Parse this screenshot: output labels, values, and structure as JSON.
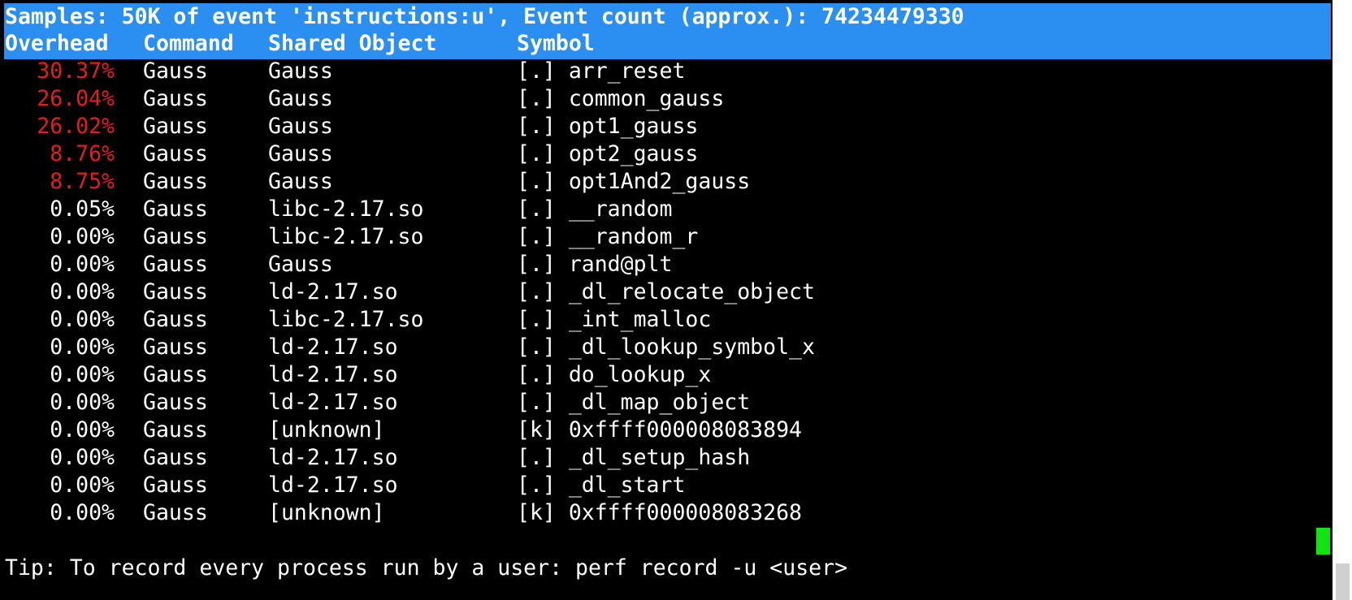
{
  "header": {
    "summary": "Samples: 50K of event 'instructions:u', Event count (approx.): 74234479330",
    "columns": {
      "overhead": "Overhead",
      "command": "Command",
      "shared_object": "Shared Object",
      "symbol": "Symbol"
    }
  },
  "rows": [
    {
      "overhead": "30.37%",
      "command": "Gauss",
      "shared_object": "Gauss",
      "symbol": "[.] arr_reset"
    },
    {
      "overhead": "26.04%",
      "command": "Gauss",
      "shared_object": "Gauss",
      "symbol": "[.] common_gauss"
    },
    {
      "overhead": "26.02%",
      "command": "Gauss",
      "shared_object": "Gauss",
      "symbol": "[.] opt1_gauss"
    },
    {
      "overhead": "8.76%",
      "command": "Gauss",
      "shared_object": "Gauss",
      "symbol": "[.] opt2_gauss"
    },
    {
      "overhead": "8.75%",
      "command": "Gauss",
      "shared_object": "Gauss",
      "symbol": "[.] opt1And2_gauss"
    },
    {
      "overhead": "0.05%",
      "command": "Gauss",
      "shared_object": "libc-2.17.so",
      "symbol": "[.] __random"
    },
    {
      "overhead": "0.00%",
      "command": "Gauss",
      "shared_object": "libc-2.17.so",
      "symbol": "[.] __random_r"
    },
    {
      "overhead": "0.00%",
      "command": "Gauss",
      "shared_object": "Gauss",
      "symbol": "[.] rand@plt"
    },
    {
      "overhead": "0.00%",
      "command": "Gauss",
      "shared_object": "ld-2.17.so",
      "symbol": "[.] _dl_relocate_object"
    },
    {
      "overhead": "0.00%",
      "command": "Gauss",
      "shared_object": "libc-2.17.so",
      "symbol": "[.] _int_malloc"
    },
    {
      "overhead": "0.00%",
      "command": "Gauss",
      "shared_object": "ld-2.17.so",
      "symbol": "[.] _dl_lookup_symbol_x"
    },
    {
      "overhead": "0.00%",
      "command": "Gauss",
      "shared_object": "ld-2.17.so",
      "symbol": "[.] do_lookup_x"
    },
    {
      "overhead": "0.00%",
      "command": "Gauss",
      "shared_object": "ld-2.17.so",
      "symbol": "[.] _dl_map_object"
    },
    {
      "overhead": "0.00%",
      "command": "Gauss",
      "shared_object": "[unknown]",
      "symbol": "[k] 0xffff000008083894"
    },
    {
      "overhead": "0.00%",
      "command": "Gauss",
      "shared_object": "ld-2.17.so",
      "symbol": "[.] _dl_setup_hash"
    },
    {
      "overhead": "0.00%",
      "command": "Gauss",
      "shared_object": "ld-2.17.so",
      "symbol": "[.] _dl_start"
    },
    {
      "overhead": "0.00%",
      "command": "Gauss",
      "shared_object": "[unknown]",
      "symbol": "[k] 0xffff000008083268"
    }
  ],
  "tip": "Tip: To record every process run by a user: perf record -u <user>",
  "colors": {
    "header_bg": "#2a8ff0",
    "hot_overhead": "#e41e1e",
    "cursor": "#11e411",
    "background": "#000000",
    "text": "#ffffff"
  }
}
